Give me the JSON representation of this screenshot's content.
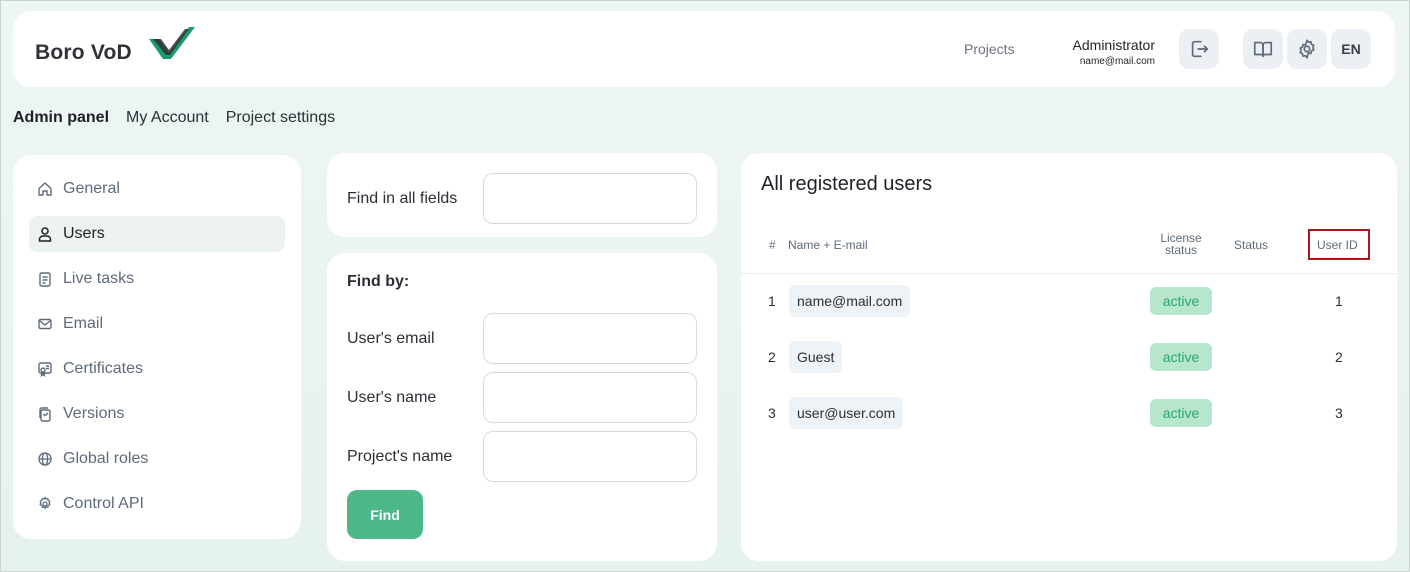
{
  "header": {
    "logo_text": "Boro VoD",
    "nav_projects": "Projects",
    "user_name": "Administrator",
    "user_email": "name@mail.com",
    "language": "EN",
    "accent_color": "#1a9b6c"
  },
  "top_tabs": [
    {
      "label": "Admin panel",
      "active": true
    },
    {
      "label": "My Account",
      "active": false
    },
    {
      "label": "Project settings",
      "active": false
    }
  ],
  "sidebar": {
    "items": [
      {
        "label": "General",
        "icon": "home-icon"
      },
      {
        "label": "Users",
        "icon": "user-icon",
        "selected": true
      },
      {
        "label": "Live tasks",
        "icon": "clipboard-icon"
      },
      {
        "label": "Email",
        "icon": "mail-icon"
      },
      {
        "label": "Certificates",
        "icon": "certificate-icon"
      },
      {
        "label": "Versions",
        "icon": "versions-icon"
      },
      {
        "label": "Global roles",
        "icon": "globe-icon"
      },
      {
        "label": "Control API",
        "icon": "gear-icon"
      }
    ]
  },
  "search": {
    "all_fields_label": "Find in all fields",
    "all_fields_value": ""
  },
  "find_by": {
    "title": "Find by:",
    "email_label": "User's email",
    "name_label": "User's name",
    "project_label": "Project's name",
    "find_button": "Find"
  },
  "users": {
    "title": "All registered users",
    "columns": {
      "num": "#",
      "name_email": "Name + E-mail",
      "license_line1": "License",
      "license_line2": "status",
      "status": "Status",
      "user_id": "User ID"
    },
    "rows": [
      {
        "num": "1",
        "name": "name@mail.com",
        "license": "active",
        "id": "1"
      },
      {
        "num": "2",
        "name": "Guest",
        "license": "active",
        "id": "2"
      },
      {
        "num": "3",
        "name": "user@user.com",
        "license": "active",
        "id": "3"
      }
    ]
  }
}
